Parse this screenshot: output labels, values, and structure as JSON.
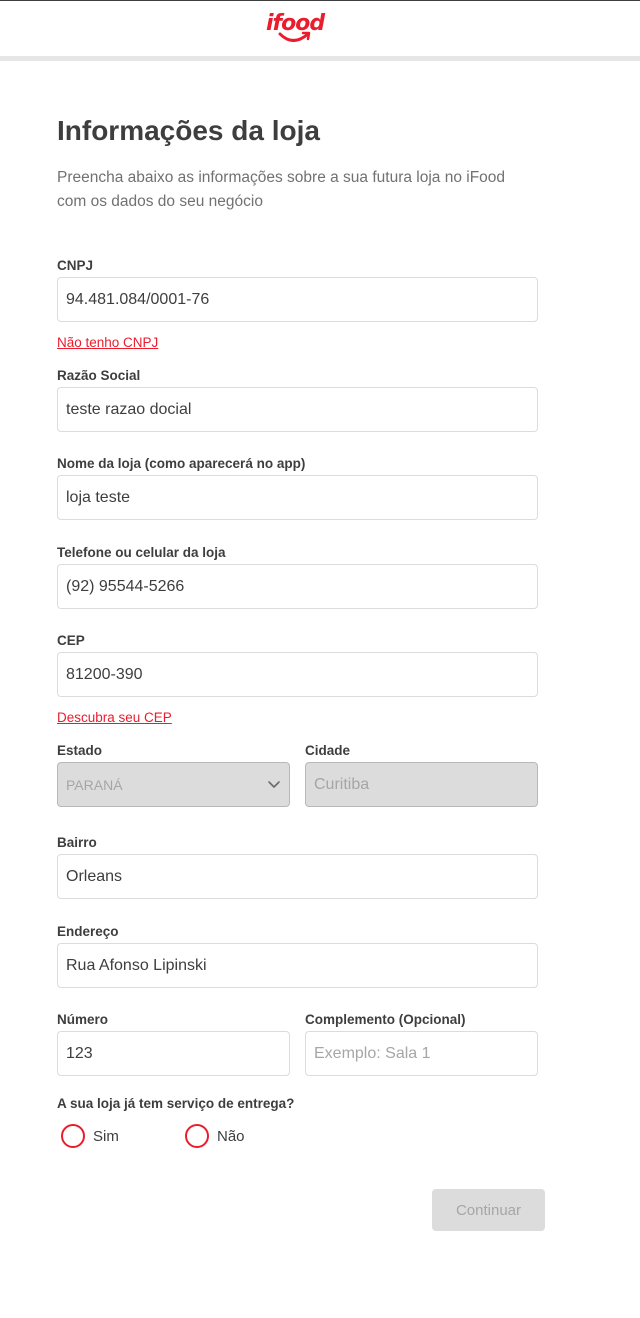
{
  "header": {
    "logo_text": "ifood",
    "brand_color": "#ea1d2c"
  },
  "page": {
    "title": "Informações da loja",
    "subtitle": "Preencha abaixo as informações sobre a sua futura loja no iFood com os dados do seu negócio"
  },
  "form": {
    "cnpj": {
      "label": "CNPJ",
      "value": "94.481.084/0001-76"
    },
    "no_cnpj_link": "Não tenho CNPJ",
    "razao_social": {
      "label": "Razão Social",
      "value": "teste razao docial"
    },
    "store_name": {
      "label": "Nome da loja (como aparecerá no app)",
      "value": "loja teste"
    },
    "phone": {
      "label": "Telefone ou celular da loja",
      "value": "(92) 95544-5266"
    },
    "cep": {
      "label": "CEP",
      "value": "81200-390"
    },
    "find_cep_link": "Descubra seu CEP",
    "estado": {
      "label": "Estado",
      "value": "PARANÁ",
      "icon": "chevron-down-icon"
    },
    "cidade": {
      "label": "Cidade",
      "value": "Curitiba"
    },
    "bairro": {
      "label": "Bairro",
      "value": "Orleans"
    },
    "endereco": {
      "label": "Endereço",
      "value": "Rua Afonso Lipinski"
    },
    "numero": {
      "label": "Número",
      "value": "123"
    },
    "complemento": {
      "label": "Complemento (Opcional)",
      "value": "",
      "placeholder": "Exemplo: Sala 1"
    },
    "delivery_question": "A sua loja já tem serviço de entrega?",
    "delivery_options": [
      {
        "label": "Sim"
      },
      {
        "label": "Não"
      }
    ],
    "continue_label": "Continuar"
  }
}
